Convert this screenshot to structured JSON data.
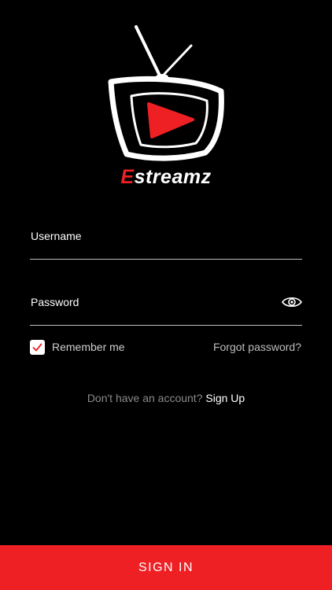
{
  "brand": {
    "name_first": "E",
    "name_rest": "streamz",
    "logo_icon": "tv-play-icon"
  },
  "form": {
    "username_label": "Username",
    "username_value": "",
    "password_label": "Password",
    "password_value": "",
    "show_password_icon": "eye-icon",
    "remember_label": "Remember me",
    "remember_checked": true,
    "forgot_label": "Forgot password?"
  },
  "signup": {
    "prompt": "Don't have an account?",
    "link": "Sign Up"
  },
  "actions": {
    "sign_in": "SIGN IN"
  },
  "colors": {
    "accent": "#ee2024",
    "background": "#000000",
    "text": "#ffffff"
  }
}
